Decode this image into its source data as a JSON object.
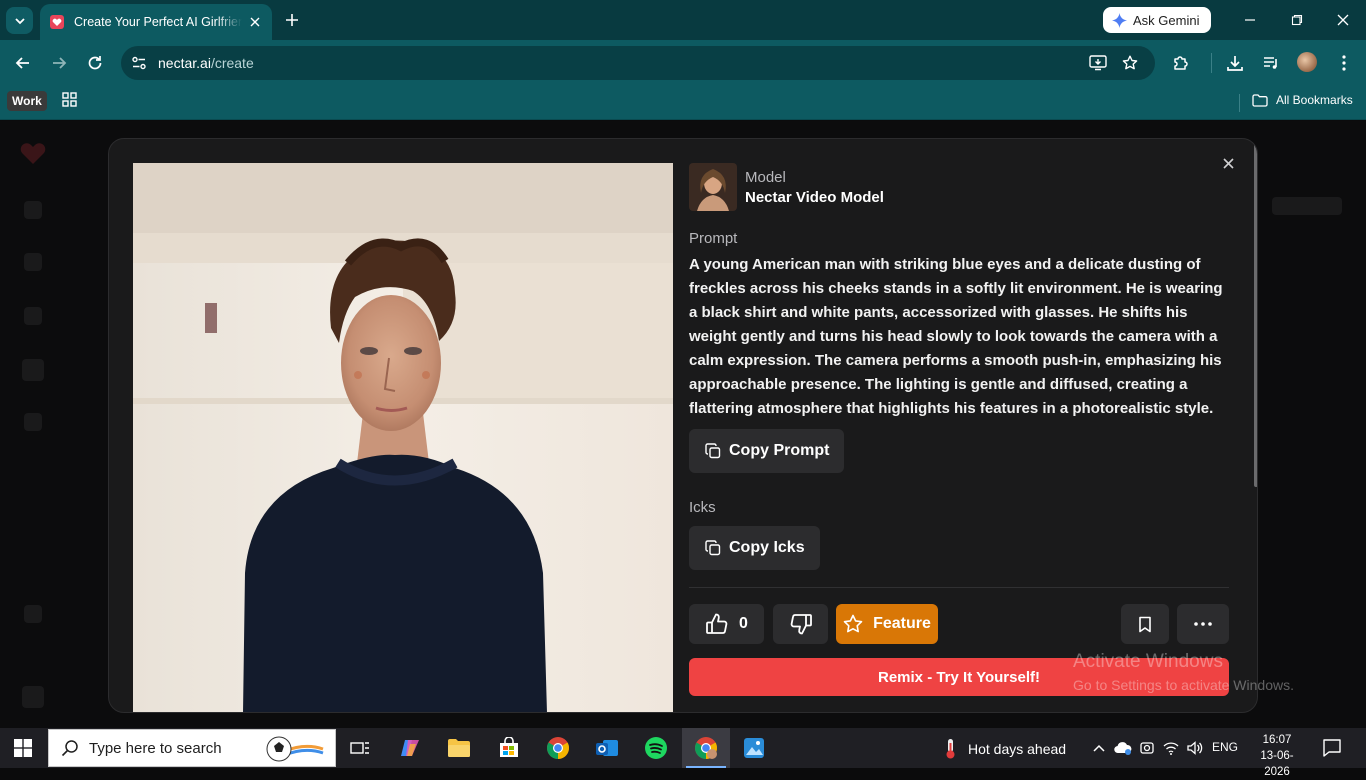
{
  "browser": {
    "tab_title": "Create Your Perfect AI Girlfriend",
    "gemini_label": "Ask Gemini",
    "url_domain": "nectar.ai",
    "url_path": "/create",
    "bookmark_chip": "Work",
    "all_bookmarks": "All Bookmarks"
  },
  "modal": {
    "model_label": "Model",
    "model_name": "Nectar Video Model",
    "prompt_label": "Prompt",
    "prompt_text": "A young American man with striking blue eyes and a delicate dusting of freckles across his cheeks stands in a softly lit environment. He is wearing a black shirt and white pants, accessorized with glasses. He shifts his weight gently and turns his head slowly to look towards the camera with a calm expression. The camera performs a smooth push-in, emphasizing his approachable presence. The lighting is gentle and diffused, creating a flattering atmosphere that highlights his features in a photorealistic style.",
    "copy_prompt": "Copy Prompt",
    "icks_label": "Icks",
    "copy_icks": "Copy Icks",
    "like_count": "0",
    "feature_label": "Feature",
    "remix_label": "Remix - Try It Yourself!"
  },
  "watermark": {
    "line1": "Activate Windows",
    "line2": "Go to Settings to activate Windows."
  },
  "taskbar": {
    "search_placeholder": "Type here to search",
    "weather": "Hot days ahead",
    "lang": "ENG",
    "time": "16:07",
    "date": "13-06-2026"
  },
  "colors": {
    "chrome_teal": "#0d5a61",
    "feature_orange": "#d97706",
    "remix_red": "#ef4343",
    "modal_bg": "#1a1a1b"
  }
}
